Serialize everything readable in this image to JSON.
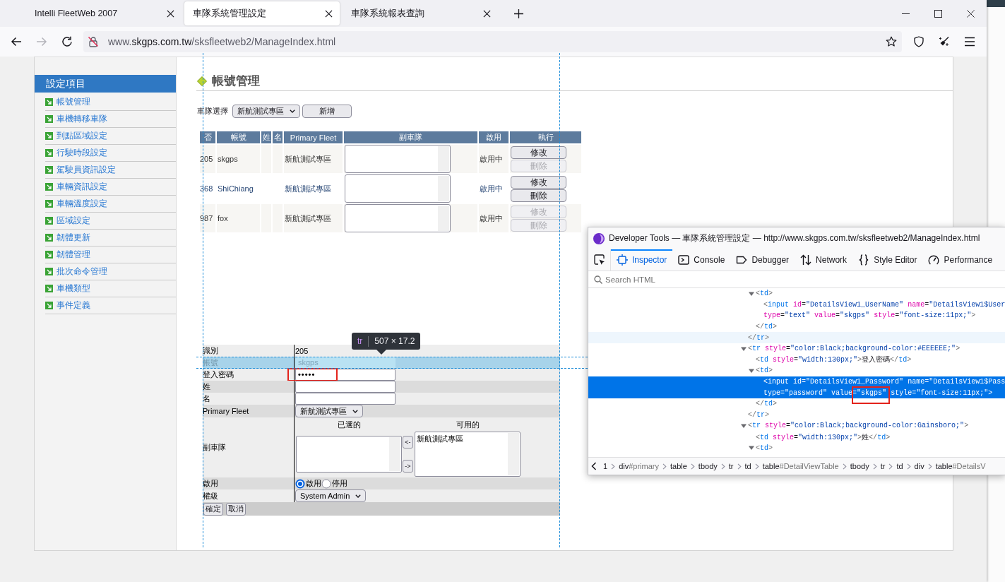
{
  "browser": {
    "tabs": [
      {
        "title": "Intelli FleetWeb 2007",
        "selected": false
      },
      {
        "title": "車隊系統管理設定",
        "selected": true
      },
      {
        "title": "車隊系統報表查詢",
        "selected": false
      }
    ],
    "forward_disabled": true,
    "url": {
      "prefix": "www.",
      "domain": "skgps.com.tw",
      "path": "/sksfleetweb2/ManageIndex.html"
    }
  },
  "sidebar": {
    "title": "設定項目",
    "items": [
      "帳號管理",
      "車機轉移車隊",
      "到點區域設定",
      "行駛時段設定",
      "駕駛員資訊設定",
      "車輛資訊設定",
      "車輛溫度設定",
      "區域設定",
      "韌體更新",
      "韌體管理",
      "批次命令管理",
      "車機類型",
      "事件定義"
    ]
  },
  "page": {
    "title": "帳號管理",
    "fleet_filter": {
      "label": "車隊選擇",
      "value": "新航測試專區"
    },
    "add_button": "新增"
  },
  "accounts_table": {
    "columns": [
      "否",
      "帳號",
      "姓",
      "名",
      "Primary Fleet",
      "副車隊",
      "啟用",
      "執行"
    ],
    "rows": [
      {
        "id": "205",
        "account": "skgps",
        "primary_fleet": "新航測試專區",
        "status": "啟用中",
        "actions": [
          {
            "label": "修改",
            "disabled": false
          },
          {
            "label": "刪除",
            "disabled": true
          }
        ]
      },
      {
        "id": "368",
        "account": "ShiChiang",
        "primary_fleet": "新航測試專區",
        "status": "啟用中",
        "actions": [
          {
            "label": "修改",
            "disabled": false
          },
          {
            "label": "刪除",
            "disabled": false
          }
        ]
      },
      {
        "id": "987",
        "account": "fox",
        "primary_fleet": "新航測試專區",
        "status": "啟用中",
        "actions": [
          {
            "label": "修改",
            "disabled": true
          },
          {
            "label": "刪除",
            "disabled": true
          }
        ]
      }
    ]
  },
  "detail_form": {
    "rows": [
      {
        "label": "識別",
        "kind": "text",
        "value": "205",
        "highlighted": false
      },
      {
        "label": "帳號",
        "kind": "input",
        "value": "skgps",
        "highlighted": true
      },
      {
        "label": "登入密碼",
        "kind": "password",
        "value": "•••••",
        "highlighted": false,
        "annotated": true
      },
      {
        "label": "姓",
        "kind": "input",
        "highlighted": false
      },
      {
        "label": "名",
        "kind": "input",
        "highlighted": false
      },
      {
        "label": "Primary Fleet",
        "kind": "select",
        "value": "新航測試專區",
        "highlighted": false
      },
      {
        "label": "副車隊",
        "kind": "dual_list",
        "selected_heading": "已選的",
        "available_heading": "可用的",
        "available_items": [
          "新航測試專區"
        ],
        "move_left": "<-",
        "move_right": "->",
        "highlighted": false
      },
      {
        "label": "啟用",
        "kind": "radio",
        "options": [
          {
            "label": "啟用",
            "selected": true
          },
          {
            "label": "停用",
            "selected": false
          }
        ],
        "highlighted": false
      },
      {
        "label": "權級",
        "kind": "select",
        "value": "System Admin",
        "highlighted": false
      }
    ],
    "buttons": [
      "確定",
      "取消"
    ]
  },
  "inspector_tooltip": {
    "tag": "tr",
    "size": "507 × 17.2"
  },
  "devtools": {
    "title": "Developer Tools — 車隊系統管理設定 — http://www.skgps.com.tw/sksfleetweb2/ManageIndex.html",
    "tools": [
      {
        "label": "Inspector",
        "kind": "inspector",
        "selected": true
      },
      {
        "label": "Console",
        "kind": "console",
        "selected": false
      },
      {
        "label": "Debugger",
        "kind": "debugger",
        "selected": false
      },
      {
        "label": "Network",
        "kind": "network",
        "selected": false
      },
      {
        "label": "Style Editor",
        "kind": "style_editor",
        "selected": false
      },
      {
        "label": "Performance",
        "kind": "performance",
        "selected": false
      }
    ],
    "search": {
      "placeholder": "Search HTML"
    },
    "markup": [
      {
        "children": [
          {
            "open": [
              "<td>"
            ],
            "expanded": true,
            "children": [
              {
                "open": [
                  "<input id=\"DetailsView1_UserName\" name=\"DetailsView1$User",
                  "type=\"text\" value=\"skgps\" style=\"font-size:11px;\">"
                ]
              }
            ],
            "close": "</td>"
          }
        ],
        "close": "</tr>",
        "hovered": true
      },
      {
        "open": [
          "<tr style=\"color:Black;background-color:#EEEEEE;\">"
        ],
        "expanded": true,
        "children": [
          {
            "open": [
              "<td style=\"width:130px;\">登入密碼</td>"
            ]
          },
          {
            "open": [
              "<td>"
            ],
            "expanded": true,
            "children": [
              {
                "open": [
                  "<input id=\"DetailsView1_Password\" name=\"DetailsView1$Pass",
                  "type=\"password\" value=\"skgps\" style=\"font-size:11px;\">"
                ],
                "selected": true,
                "annotated": true
              }
            ],
            "close": "</td>"
          }
        ],
        "close": "</tr>"
      },
      {
        "open": [
          "<tr style=\"color:Black;background-color:Gainsboro;\">"
        ],
        "expanded": true,
        "children": [
          {
            "open": [
              "<td style=\"width:130px;\">姓</td>"
            ]
          },
          {
            "open": [
              "<td>"
            ],
            "expanded": true
          }
        ]
      }
    ],
    "breadcrumbs": [
      "1",
      "div#primary",
      "table",
      "tbody",
      "tr",
      "td",
      "table#DetailViewTable",
      "tbody",
      "tr",
      "td",
      "div",
      "table#DetailsV"
    ]
  }
}
